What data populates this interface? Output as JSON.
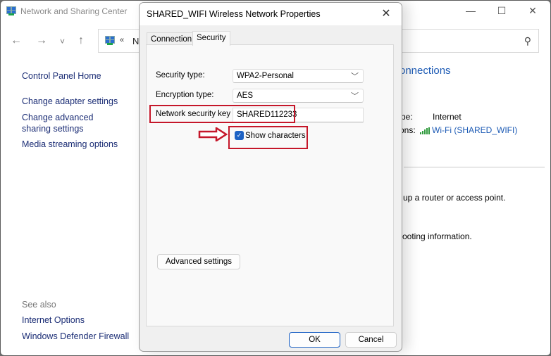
{
  "background_window": {
    "title": "Network and Sharing Center",
    "controls": {
      "minimize": "—",
      "maximize": "☐",
      "close": "✕"
    },
    "nav": {
      "back": "←",
      "forward": "→",
      "recent": "˅",
      "up": "↑"
    },
    "address": {
      "chevron": "«",
      "crumb": "Ne",
      "search_icon": "⚲"
    },
    "sidebar": {
      "links": [
        "Control Panel Home",
        "Change adapter settings",
        "Change advanced sharing settings",
        "Media streaming options"
      ],
      "see_also_label": "See also",
      "see_also_links": [
        "Internet Options",
        "Windows Defender Firewall"
      ]
    },
    "main": {
      "heading_partial": "onnections",
      "access_type_label_partial": "pe:",
      "access_type_value": "Internet",
      "connections_label_partial": "ons:",
      "connection_link": "Wi-Fi (SHARED_WIFI)",
      "text1_partial": "up a router or access point.",
      "text2_partial": "ooting information."
    }
  },
  "dialog": {
    "title": "SHARED_WIFI Wireless Network Properties",
    "close_icon": "✕",
    "tabs": [
      {
        "label": "Connection",
        "active": false
      },
      {
        "label": "Security",
        "active": true
      }
    ],
    "security_type": {
      "label": "Security type:",
      "value": "WPA2-Personal"
    },
    "encryption_type": {
      "label": "Encryption type:",
      "value": "AES"
    },
    "network_key": {
      "label": "Network security key",
      "value": "SHARED112233"
    },
    "show_characters": {
      "label": "Show characters",
      "checked": true,
      "check_glyph": "✓"
    },
    "dropdown_chevron": "﹀",
    "advanced_settings_label": "Advanced settings",
    "ok_label": "OK",
    "cancel_label": "Cancel",
    "annotation_color": "#c5172a",
    "accent_color": "#1d62c4"
  }
}
